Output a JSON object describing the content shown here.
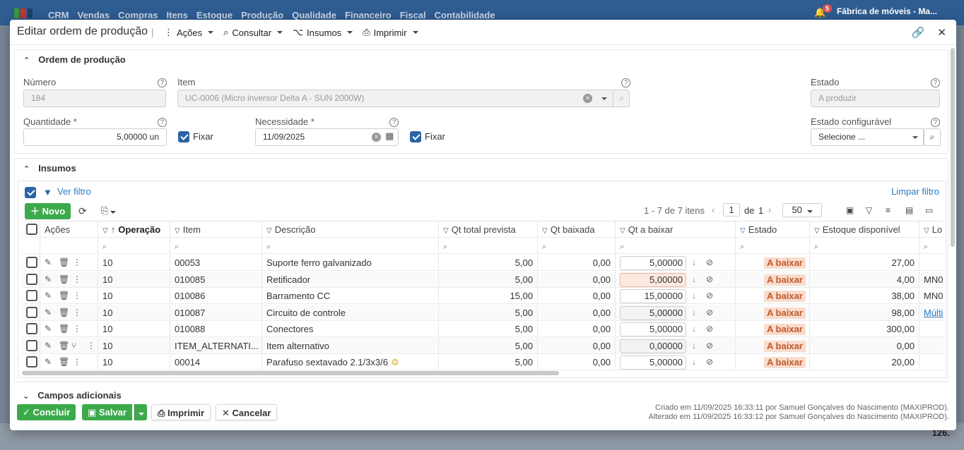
{
  "topbar": {
    "nav": [
      "CRM",
      "Vendas",
      "Compras",
      "Itens",
      "Estoque",
      "Produção",
      "Qualidade",
      "Financeiro",
      "Fiscal",
      "Contabilidade"
    ],
    "notification_count": "5",
    "company": "Fábrica de móveis - Ma..."
  },
  "modal": {
    "title": "Editar ordem de produção",
    "menus": [
      "Ações",
      "Consultar",
      "Insumos",
      "Imprimir"
    ]
  },
  "order": {
    "section_title": "Ordem de produção",
    "numero_label": "Número",
    "numero_value": "184",
    "item_label": "Item",
    "item_value": "UC-0006 (Micro inversor Delta A - SUN 2000W)",
    "estado_label": "Estado",
    "estado_value": "A produzir",
    "quantidade_label": "Quantidade *",
    "quantidade_value": "5,00000 un",
    "fixar1_label": "Fixar",
    "necessidade_label": "Necessidade *",
    "necessidade_value": "11/09/2025",
    "fixar2_label": "Fixar",
    "estado_config_label": "Estado configurável",
    "estado_config_placeholder": "Selecione ..."
  },
  "insumos": {
    "section_title": "Insumos",
    "ver_filtro": "Ver filtro",
    "limpar_filtro": "Limpar filtro",
    "novo_label": "Novo",
    "pagination_text": "1 - 7 de 7 itens",
    "page": "1",
    "de_label": "de",
    "total_pages": "1",
    "page_size": "50",
    "columns": [
      "Ações",
      "Operação",
      "Item",
      "Descrição",
      "Qt total prevista",
      "Qt baixada",
      "Qt a baixar",
      "Estado",
      "Estoque disponível",
      "Lo"
    ],
    "rows": [
      {
        "op": "10",
        "item": "00053",
        "desc": "Suporte ferro galvanizado",
        "prev": "5,00",
        "baix": "0,00",
        "abaixar": "5,00000",
        "estado": "A baixar",
        "estoque": "27,00",
        "lo": ""
      },
      {
        "op": "10",
        "item": "010085",
        "desc": "Retificador",
        "prev": "5,00",
        "baix": "0,00",
        "abaixar": "5,00000",
        "estado": "A baixar",
        "estoque": "4,00",
        "lo": "MN0"
      },
      {
        "op": "10",
        "item": "010086",
        "desc": "Barramento CC",
        "prev": "15,00",
        "baix": "0,00",
        "abaixar": "15,00000",
        "estado": "A baixar",
        "estoque": "38,00",
        "lo": "MN0"
      },
      {
        "op": "10",
        "item": "010087",
        "desc": "Circuito de controle",
        "prev": "5,00",
        "baix": "0,00",
        "abaixar": "5,00000",
        "estado": "A baixar",
        "estoque": "98,00",
        "lo": "Múlti"
      },
      {
        "op": "10",
        "item": "010088",
        "desc": "Conectores",
        "prev": "5,00",
        "baix": "0,00",
        "abaixar": "5,00000",
        "estado": "A baixar",
        "estoque": "300,00",
        "lo": ""
      },
      {
        "op": "10",
        "item": "ITEM_ALTERNATI...",
        "desc": "Item alternativo",
        "prev": "5,00",
        "baix": "0,00",
        "abaixar": "0,00000",
        "estado": "A baixar",
        "estoque": "0,00",
        "lo": ""
      },
      {
        "op": "10",
        "item": "00014",
        "desc": "Parafuso sextavado 2.1/3x3/6",
        "prev": "5,00",
        "baix": "0,00",
        "abaixar": "5,00000",
        "estado": "A baixar",
        "estoque": "20,00",
        "lo": ""
      }
    ]
  },
  "campos": {
    "section_title": "Campos adicionais"
  },
  "actions": {
    "concluir": "Concluir",
    "salvar": "Salvar",
    "imprimir": "Imprimir",
    "cancelar": "Cancelar"
  },
  "footer": {
    "criado": "Criado em 11/09/2025 16:33:11 por Samuel Gonçalves do Nascimento (MAXIPROD).",
    "alterado": "Alterado em 11/09/2025 16:33:12 por Samuel Gonçalves do Nascimento (MAXIPROD)."
  },
  "background_number": "126."
}
